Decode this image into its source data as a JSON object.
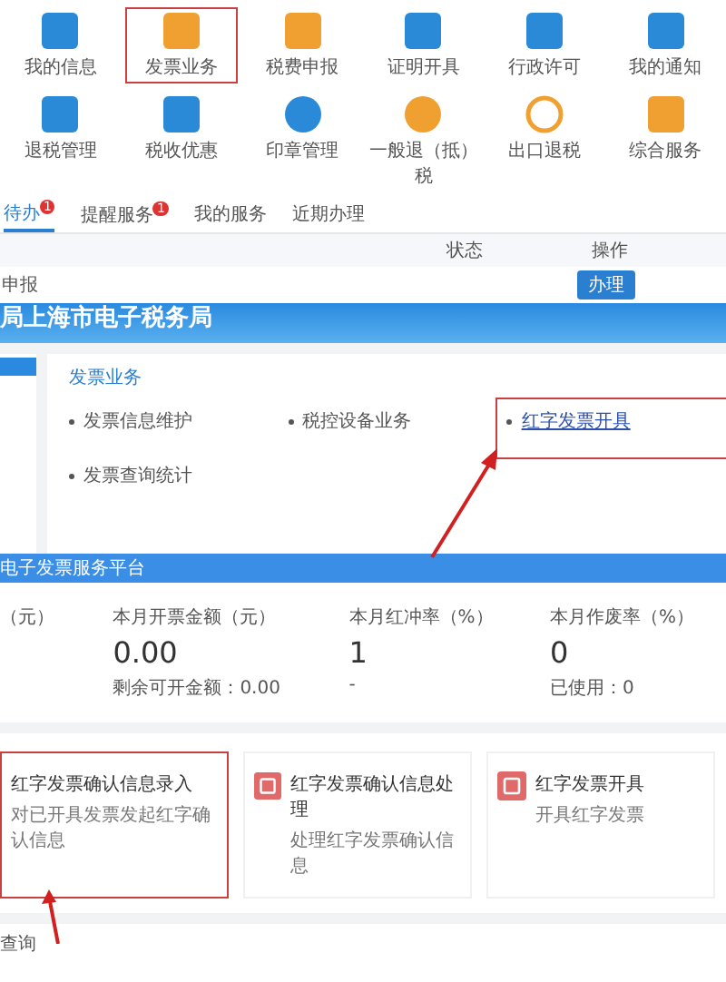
{
  "icon_grid": [
    {
      "label": "我的信息",
      "kind": "square",
      "boxed": false
    },
    {
      "label": "发票业务",
      "kind": "square-warm",
      "boxed": true
    },
    {
      "label": "税费申报",
      "kind": "square-warm",
      "boxed": false
    },
    {
      "label": "证明开具",
      "kind": "square",
      "boxed": false
    },
    {
      "label": "行政许可",
      "kind": "square",
      "boxed": false
    },
    {
      "label": "我的通知",
      "kind": "square",
      "boxed": false
    },
    {
      "label": "退税管理",
      "kind": "square",
      "boxed": false
    },
    {
      "label": "税收优惠",
      "kind": "square",
      "boxed": false
    },
    {
      "label": "印章管理",
      "kind": "disc",
      "boxed": false
    },
    {
      "label": "一般退（抵）税",
      "kind": "disc-warm",
      "boxed": false
    },
    {
      "label": "出口退税",
      "kind": "ring",
      "boxed": false
    },
    {
      "label": "综合服务",
      "kind": "square-warm",
      "boxed": false
    }
  ],
  "tabs": [
    {
      "label": "待办",
      "badge": "1",
      "selected": true
    },
    {
      "label": "提醒服务",
      "badge": "1",
      "selected": false
    },
    {
      "label": "我的服务",
      "selected": false
    },
    {
      "label": "近期办理",
      "selected": false
    }
  ],
  "table": {
    "columns": [
      "状态",
      "操作"
    ],
    "rows": [
      {
        "name": "申报",
        "action": "办理"
      }
    ]
  },
  "banner": {
    "title": "局上海市电子税务局"
  },
  "section": {
    "title": "发票业务",
    "links": [
      {
        "label": "发票信息维护",
        "boxed": false
      },
      {
        "label": "税控设备业务",
        "boxed": false
      },
      {
        "label": "红字发票开具",
        "boxed": true
      },
      {
        "label": "发票查询统计",
        "boxed": false
      }
    ]
  },
  "platform": {
    "title": "电子发票服务平台",
    "stats": [
      {
        "label": "（元）"
      },
      {
        "label": "本月开票金额（元）",
        "value": "0.00",
        "note": "剩余可开金额：0.00"
      },
      {
        "label": "本月红冲率（%）",
        "value": "1",
        "note": "-"
      },
      {
        "label": "本月作废率（%）",
        "value": "0",
        "note": "已使用：0"
      }
    ]
  },
  "cards": [
    {
      "title": "红字发票确认信息录入",
      "desc": "对已开具发票发起红字确认信息",
      "kind": "plain",
      "boxed": true
    },
    {
      "title": "红字发票确认信息处理",
      "desc": "处理红字发票确认信息",
      "kind": "icon",
      "boxed": false
    },
    {
      "title": "红字发票开具",
      "desc": "开具红字发票",
      "kind": "icon",
      "boxed": false
    }
  ],
  "footer": {
    "title": "查询"
  }
}
